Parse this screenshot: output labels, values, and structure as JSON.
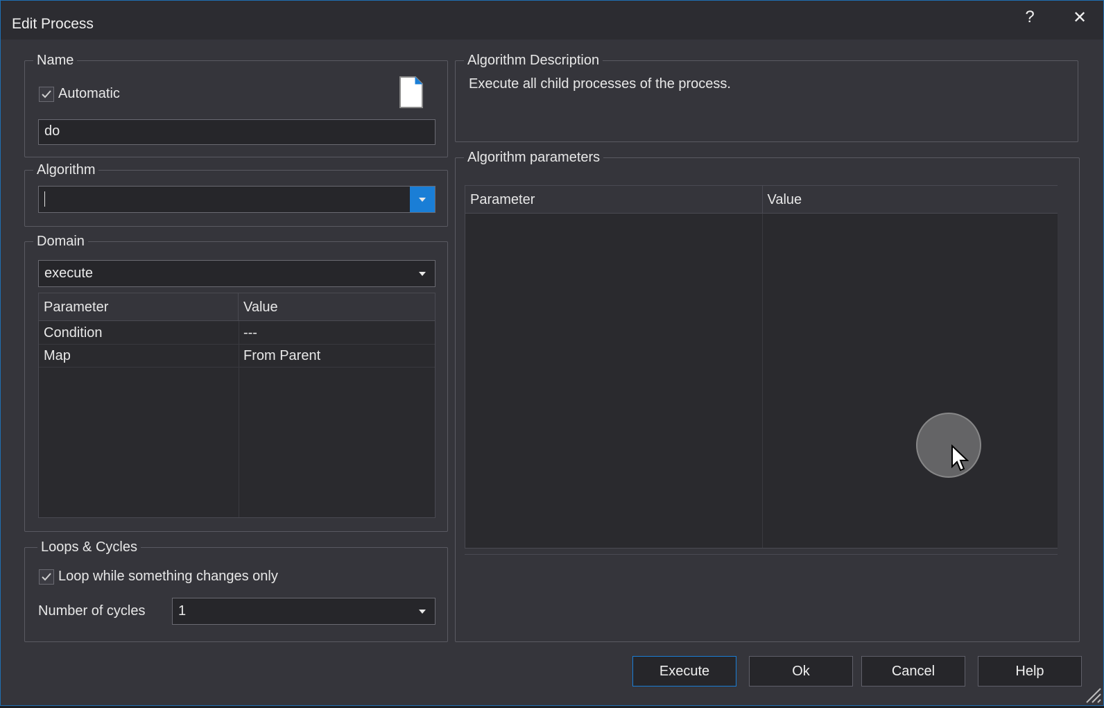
{
  "window": {
    "title": "Edit Process",
    "help_label": "?",
    "close_label": "✕"
  },
  "name_group": {
    "legend": "Name",
    "automatic_label": "Automatic",
    "automatic_checked": true,
    "name_value": "do",
    "icon": "document-icon"
  },
  "algorithm_group": {
    "legend": "Algorithm",
    "value": ""
  },
  "domain_group": {
    "legend": "Domain",
    "value": "execute",
    "columns": [
      "Parameter",
      "Value"
    ],
    "rows": [
      {
        "parameter": "Condition",
        "value": "---"
      },
      {
        "parameter": "Map",
        "value": "From Parent"
      }
    ]
  },
  "loops_group": {
    "legend": "Loops & Cycles",
    "loop_label": "Loop while something changes only",
    "loop_checked": true,
    "cycles_label": "Number of cycles",
    "cycles_value": "1"
  },
  "description_group": {
    "legend": "Algorithm Description",
    "text": "Execute all child processes of the process."
  },
  "parameters_group": {
    "legend": "Algorithm parameters",
    "columns": [
      "Parameter",
      "Value"
    ]
  },
  "buttons": {
    "execute": "Execute",
    "ok": "Ok",
    "cancel": "Cancel",
    "help": "Help"
  }
}
